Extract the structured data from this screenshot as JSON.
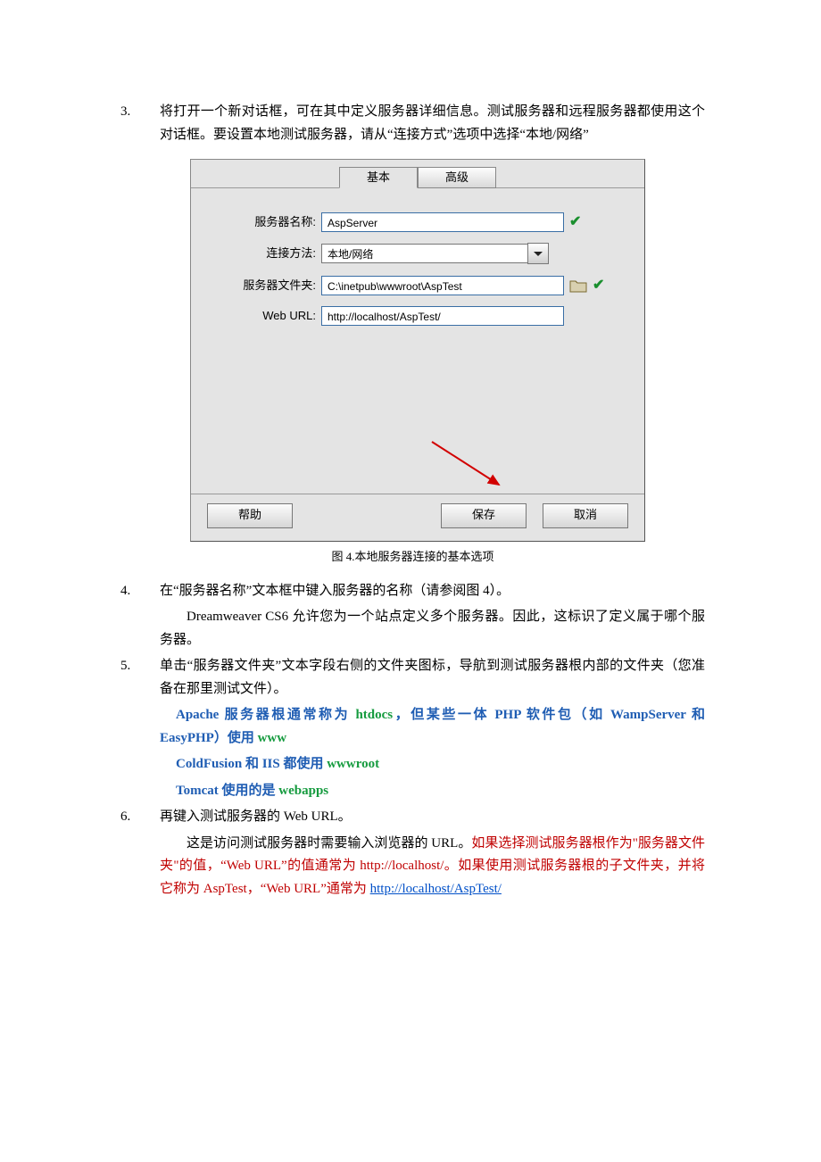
{
  "steps": {
    "s3": {
      "num": "3.",
      "text": "将打开一个新对话框，可在其中定义服务器详细信息。测试服务器和远程服务器都使用这个对话框。要设置本地测试服务器，请从“连接方式”选项中选择“本地/网络”"
    },
    "s4": {
      "num": "4.",
      "text": "在“服务器名称”文本框中键入服务器的名称（请参阅图 4）。"
    },
    "s4sub": "Dreamweaver CS6 允许您为一个站点定义多个服务器。因此，这标识了定义属于哪个服务器。",
    "s5": {
      "num": "5.",
      "text": "单击“服务器文件夹”文本字段右侧的文件夹图标，导航到测试服务器根内部的文件夹（您准备在那里测试文件）。"
    },
    "s5_l1_a": "Apache 服务器根通常称为 ",
    "s5_l1_b": "htdocs",
    "s5_l1_c": "，但某些一体 PHP 软件包（如 WampServer 和 EasyPHP）使用 ",
    "s5_l1_d": "www",
    "s5_l2_a": "ColdFusion 和 IIS 都使用 ",
    "s5_l2_b": "wwwroot",
    "s5_l3_a": "Tomcat 使用的是 ",
    "s5_l3_b": "webapps",
    "s6": {
      "num": "6.",
      "text": "再键入测试服务器的 Web URL。"
    },
    "s6_a": "这是访问测试服务器时需要输入浏览器的 URL。",
    "s6_b": "如果选择测试服务器根作为\"服务器文件夹\"的值，“Web URL”的值通常为 http://localhost/。如果使用测试服务器根的子文件夹，并将它称为 AspTest，“Web URL”通常为 ",
    "s6_link": "http://localhost/AspTest/"
  },
  "caption": "图 4.本地服务器连接的基本选项",
  "dialog": {
    "tab_basic": "基本",
    "tab_adv": "高级",
    "lbl_name": "服务器名称:",
    "lbl_conn": "连接方法:",
    "lbl_folder": "服务器文件夹:",
    "lbl_url": "Web URL:",
    "val_name": "AspServer",
    "val_conn": "本地/网络",
    "val_folder": "C:\\inetpub\\wwwroot\\AspTest",
    "val_url": "http://localhost/AspTest/",
    "btn_help": "帮助",
    "btn_save": "保存",
    "btn_cancel": "取消"
  }
}
